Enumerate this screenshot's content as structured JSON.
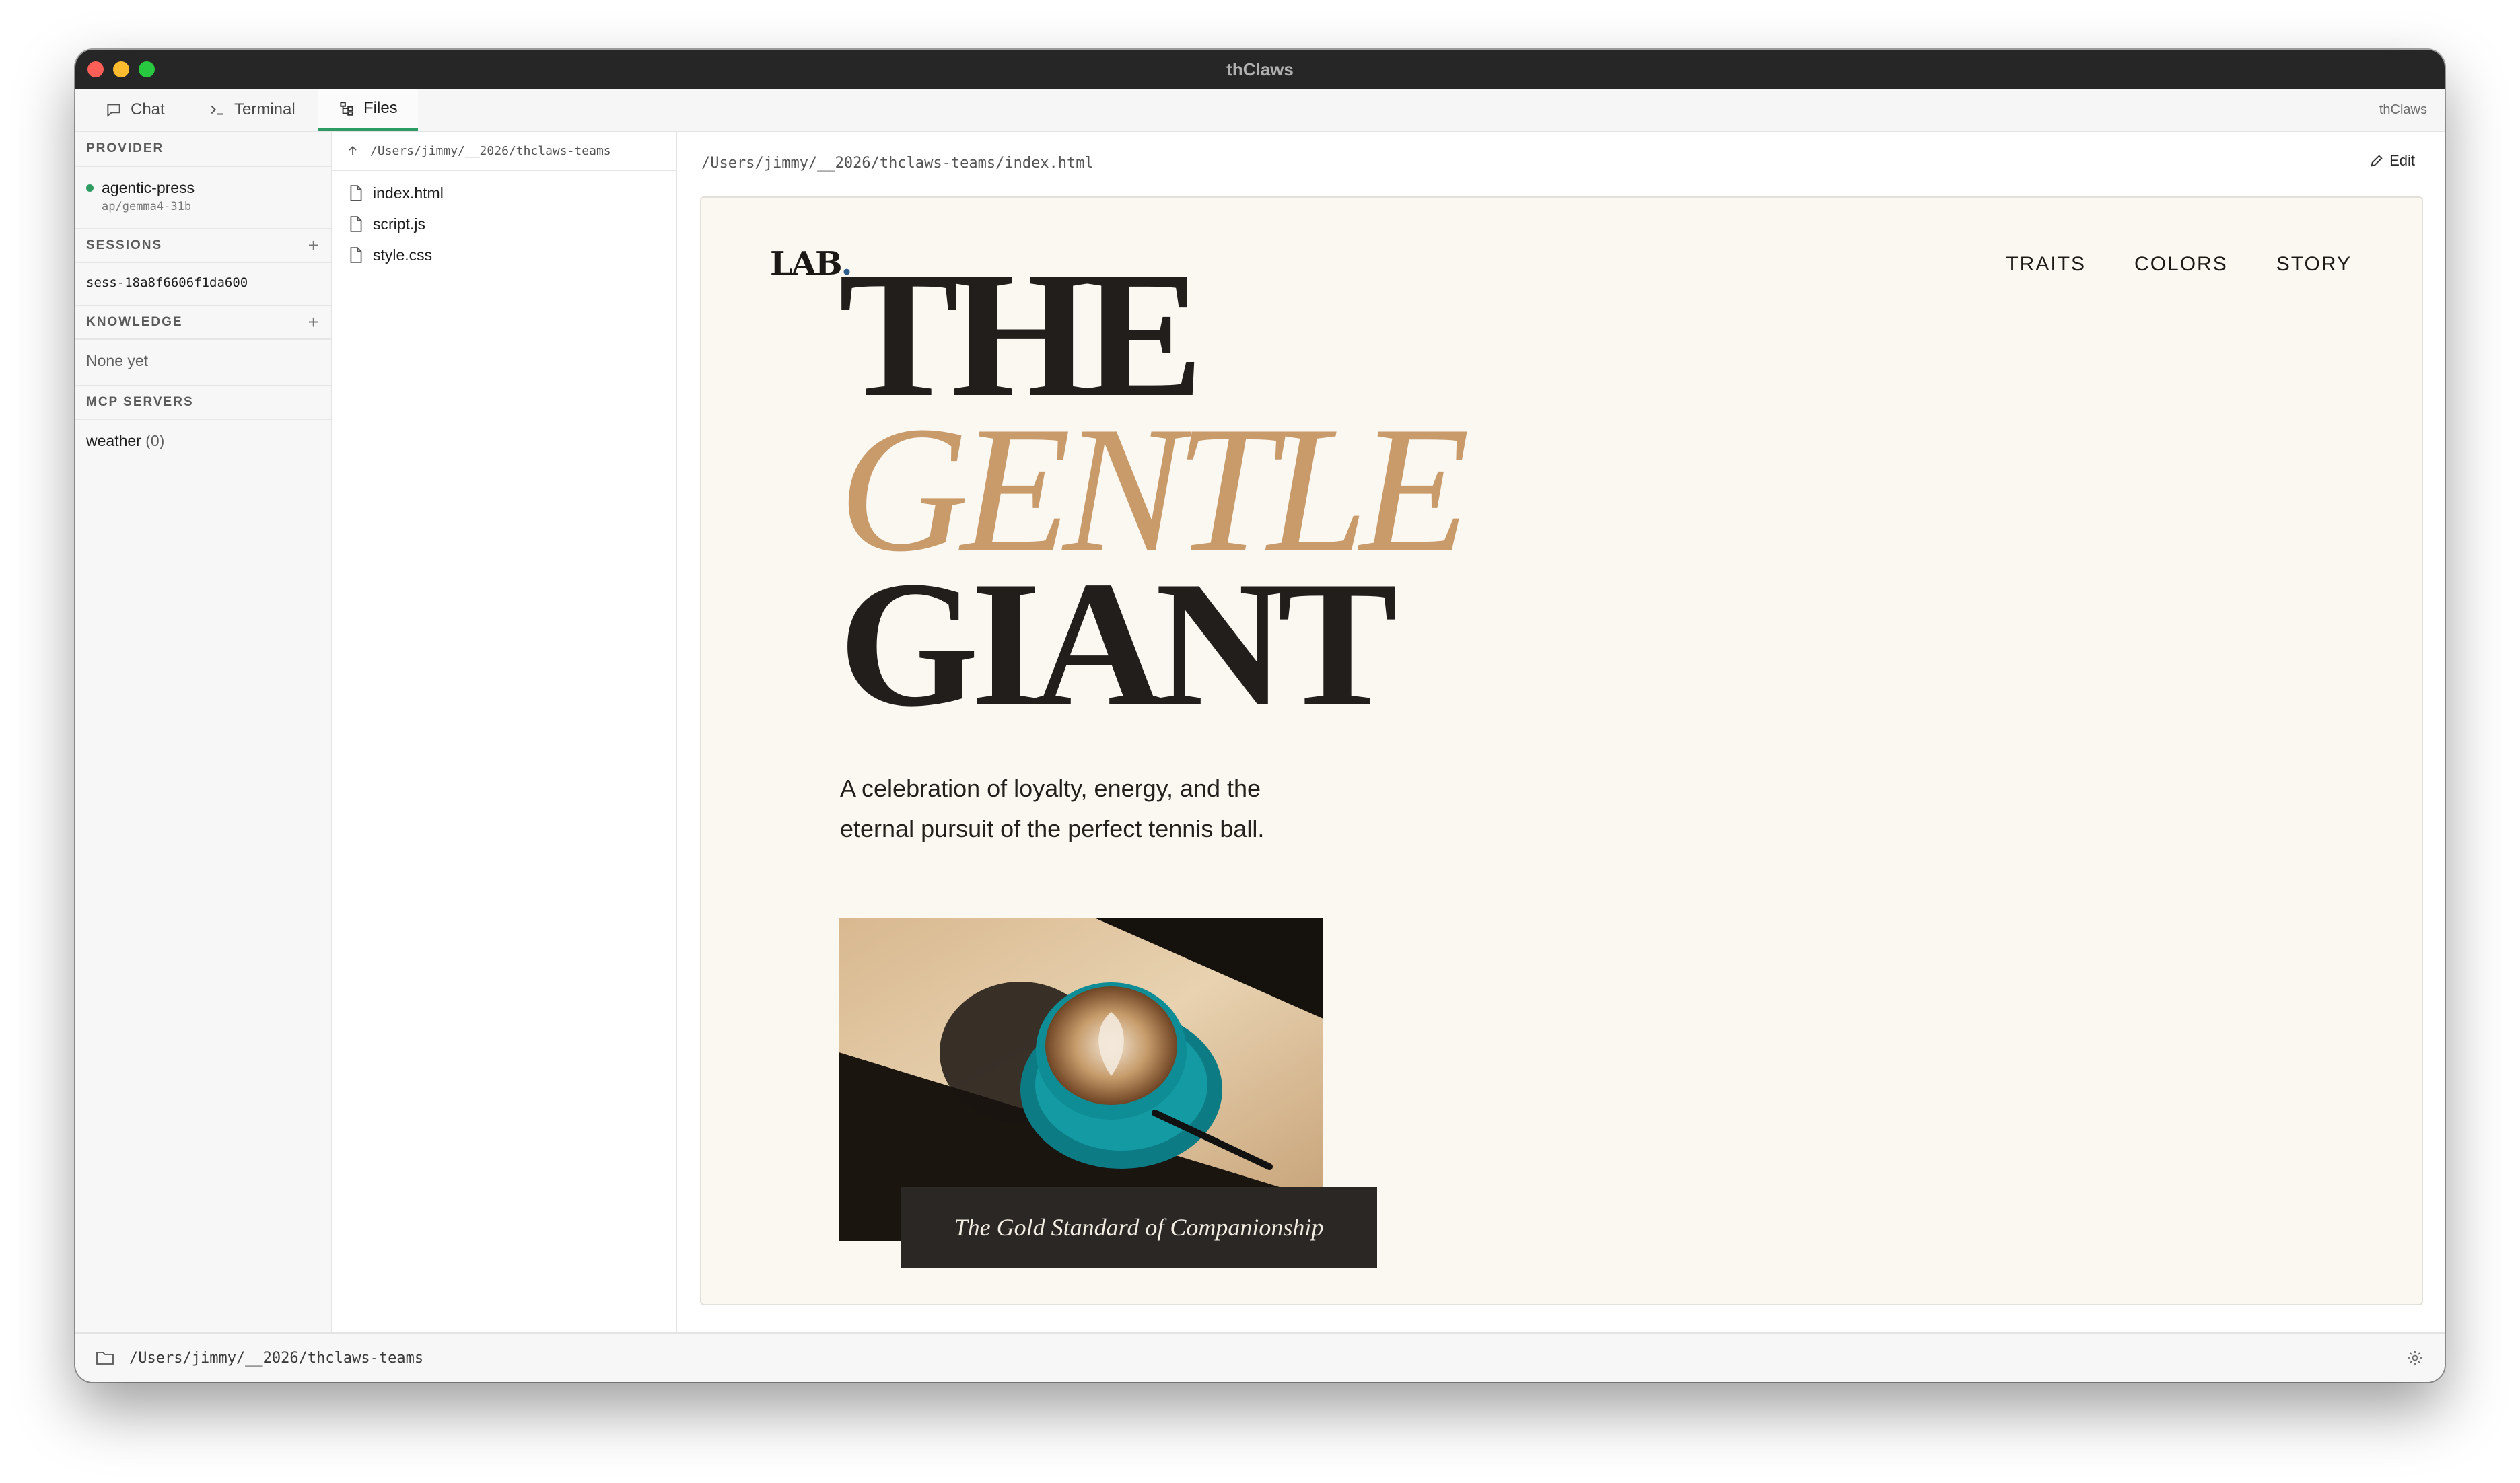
{
  "window": {
    "title": "thClaws"
  },
  "tabs": [
    {
      "label": "Chat",
      "icon": "chat-icon"
    },
    {
      "label": "Terminal",
      "icon": "terminal-icon"
    },
    {
      "label": "Files",
      "icon": "files-icon",
      "active": true
    }
  ],
  "brand": "thClaws",
  "sidebar": {
    "provider": {
      "heading": "PROVIDER",
      "name": "agentic-press",
      "model": "ap/gemma4-31b",
      "status_color": "#2e9c62"
    },
    "sessions": {
      "heading": "SESSIONS",
      "items": [
        "sess-18a8f6606f1da600"
      ]
    },
    "knowledge": {
      "heading": "KNOWLEDGE",
      "empty": "None yet"
    },
    "mcp": {
      "heading": "MCP SERVERS",
      "items": [
        {
          "name": "weather",
          "count": "(0)"
        }
      ]
    }
  },
  "files": {
    "dir": "/Users/jimmy/__2026/thclaws-teams",
    "items": [
      "index.html",
      "script.js",
      "style.css"
    ]
  },
  "main": {
    "path": "/Users/jimmy/__2026/thclaws-teams/index.html",
    "edit_label": "Edit"
  },
  "preview": {
    "logo": "LAB",
    "logo_dot": ".",
    "nav": [
      "TRAITS",
      "COLORS",
      "STORY"
    ],
    "hero": [
      "THE",
      "GENTLE",
      "GIANT"
    ],
    "subtitle_line1": "A celebration of loyalty, energy, and the",
    "subtitle_line2": "eternal pursuit of the perfect tennis ball.",
    "caption": "The Gold Standard of Companionship",
    "colors": {
      "background": "#fbf7f1",
      "accent": "#c99a6a",
      "ink": "#211e1b"
    }
  },
  "status": {
    "path": "/Users/jimmy/__2026/thclaws-teams"
  }
}
